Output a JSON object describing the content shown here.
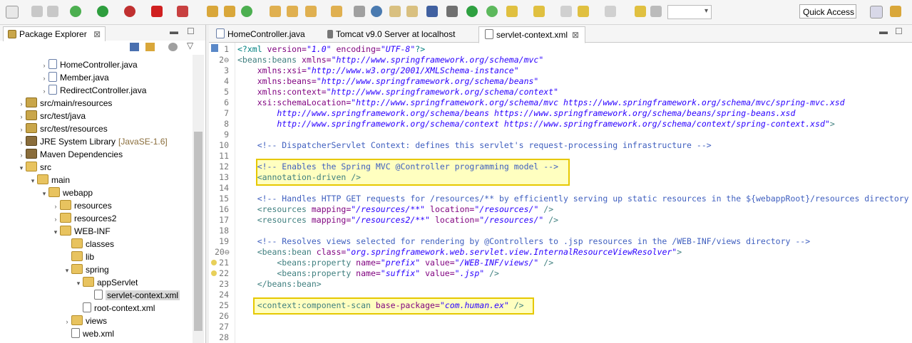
{
  "toolbar": {
    "quick_access": "Quick Access"
  },
  "package_explorer": {
    "title": "Package Explorer",
    "tree": [
      {
        "label": "HomeController.java",
        "extra": "",
        "depth": 4,
        "icon": "java",
        "twisty": ">"
      },
      {
        "label": "Member.java",
        "extra": "",
        "depth": 4,
        "icon": "java",
        "twisty": ">"
      },
      {
        "label": "RedirectController.java",
        "extra": "",
        "depth": 4,
        "icon": "java",
        "twisty": ">"
      },
      {
        "label": "src/main/resources",
        "extra": "",
        "depth": 2,
        "icon": "pkg",
        "twisty": ">"
      },
      {
        "label": "src/test/java",
        "extra": "",
        "depth": 2,
        "icon": "pkg",
        "twisty": ">"
      },
      {
        "label": "src/test/resources",
        "extra": "",
        "depth": 2,
        "icon": "pkg",
        "twisty": ">"
      },
      {
        "label": "JRE System Library",
        "extra": "[JavaSE-1.6]",
        "depth": 2,
        "icon": "lib",
        "twisty": ">"
      },
      {
        "label": "Maven Dependencies",
        "extra": "",
        "depth": 2,
        "icon": "lib",
        "twisty": ">"
      },
      {
        "label": "src",
        "extra": "",
        "depth": 2,
        "icon": "fold",
        "twisty": "v"
      },
      {
        "label": "main",
        "extra": "",
        "depth": 3,
        "icon": "fold",
        "twisty": "v"
      },
      {
        "label": "webapp",
        "extra": "",
        "depth": 4,
        "icon": "fold",
        "twisty": "v"
      },
      {
        "label": "resources",
        "extra": "",
        "depth": 5,
        "icon": "fold",
        "twisty": ">"
      },
      {
        "label": "resources2",
        "extra": "",
        "depth": 5,
        "icon": "fold",
        "twisty": ">"
      },
      {
        "label": "WEB-INF",
        "extra": "",
        "depth": 5,
        "icon": "fold",
        "twisty": "v"
      },
      {
        "label": "classes",
        "extra": "",
        "depth": 6,
        "icon": "fold",
        "twisty": ""
      },
      {
        "label": "lib",
        "extra": "",
        "depth": 6,
        "icon": "fold",
        "twisty": ""
      },
      {
        "label": "spring",
        "extra": "",
        "depth": 6,
        "icon": "fold",
        "twisty": "v"
      },
      {
        "label": "appServlet",
        "extra": "",
        "depth": 7,
        "icon": "fold",
        "twisty": "v"
      },
      {
        "label": "servlet-context.xml",
        "extra": "",
        "depth": 8,
        "icon": "xml",
        "twisty": "",
        "selected": true
      },
      {
        "label": "root-context.xml",
        "extra": "",
        "depth": 7,
        "icon": "xml",
        "twisty": ""
      },
      {
        "label": "views",
        "extra": "",
        "depth": 6,
        "icon": "fold",
        "twisty": ">"
      },
      {
        "label": "web.xml",
        "extra": "",
        "depth": 6,
        "icon": "xml",
        "twisty": ""
      }
    ]
  },
  "editor": {
    "tabs": [
      {
        "label": "HomeController.java",
        "active": false
      },
      {
        "label": "Tomcat v9.0 Server at localhost",
        "active": false
      },
      {
        "label": "servlet-context.xml",
        "active": true
      }
    ],
    "lines": [
      {
        "n": "1",
        "segs": [
          [
            "pi",
            "<?xml "
          ],
          [
            "attr",
            "version="
          ],
          [
            "val",
            "\"1.0\""
          ],
          [
            "attr",
            " encoding="
          ],
          [
            "val",
            "\"UTF-8\""
          ],
          [
            "pi",
            "?>"
          ]
        ]
      },
      {
        "n": "2⊖",
        "segs": [
          [
            "tag",
            "<beans:beans "
          ],
          [
            "attr",
            "xmlns="
          ],
          [
            "val",
            "\"http://www.springframework.org/schema/mvc\""
          ]
        ]
      },
      {
        "n": "3",
        "segs": [
          [
            "attr",
            "    xmlns:xsi="
          ],
          [
            "val",
            "\"http://www.w3.org/2001/XMLSchema-instance\""
          ]
        ]
      },
      {
        "n": "4",
        "segs": [
          [
            "attr",
            "    xmlns:beans="
          ],
          [
            "val",
            "\"http://www.springframework.org/schema/beans\""
          ]
        ]
      },
      {
        "n": "5",
        "segs": [
          [
            "attr",
            "    xmlns:context="
          ],
          [
            "val",
            "\"http://www.springframework.org/schema/context\""
          ]
        ]
      },
      {
        "n": "6",
        "segs": [
          [
            "attr",
            "    xsi:schemaLocation="
          ],
          [
            "val",
            "\"http://www.springframework.org/schema/mvc https://www.springframework.org/schema/mvc/spring-mvc.xsd"
          ]
        ]
      },
      {
        "n": "7",
        "segs": [
          [
            "val",
            "        http://www.springframework.org/schema/beans https://www.springframework.org/schema/beans/spring-beans.xsd"
          ]
        ]
      },
      {
        "n": "8",
        "segs": [
          [
            "val",
            "        http://www.springframework.org/schema/context https://www.springframework.org/schema/context/spring-context.xsd\""
          ],
          [
            "tag",
            ">"
          ]
        ]
      },
      {
        "n": "9",
        "segs": []
      },
      {
        "n": "10",
        "segs": [
          [
            "com",
            "    <!-- DispatcherServlet Context: defines this servlet's request-processing infrastructure -->"
          ]
        ]
      },
      {
        "n": "11",
        "segs": []
      },
      {
        "n": "12",
        "segs": [
          [
            "com",
            "    <!-- Enables the Spring MVC @Controller programming model -->"
          ]
        ]
      },
      {
        "n": "13",
        "segs": [
          [
            "tag",
            "    <annotation-driven />"
          ]
        ]
      },
      {
        "n": "14",
        "segs": []
      },
      {
        "n": "15",
        "segs": [
          [
            "com",
            "    <!-- Handles HTTP GET requests for /resources/** by efficiently serving up static resources in the ${webappRoot}/resources directory -->"
          ]
        ]
      },
      {
        "n": "16",
        "segs": [
          [
            "tag",
            "    <resources "
          ],
          [
            "attr",
            "mapping="
          ],
          [
            "val",
            "\"/resources/**\""
          ],
          [
            "attr",
            " location="
          ],
          [
            "val",
            "\"/resources/\""
          ],
          [
            "tag",
            " />"
          ]
        ]
      },
      {
        "n": "17",
        "segs": [
          [
            "tag",
            "    <resources "
          ],
          [
            "attr",
            "mapping="
          ],
          [
            "val",
            "\"/resources2/**\""
          ],
          [
            "attr",
            " location="
          ],
          [
            "val",
            "\"/resources/\""
          ],
          [
            "tag",
            " />"
          ]
        ]
      },
      {
        "n": "18",
        "segs": []
      },
      {
        "n": "19",
        "segs": [
          [
            "com",
            "    <!-- Resolves views selected for rendering by @Controllers to .jsp resources in the /WEB-INF/views directory -->"
          ]
        ]
      },
      {
        "n": "20⊖",
        "segs": [
          [
            "tag",
            "    <beans:bean "
          ],
          [
            "attr",
            "class="
          ],
          [
            "val",
            "\"org.springframework.web.servlet.view.InternalResourceViewResolver\""
          ],
          [
            "tag",
            ">"
          ]
        ]
      },
      {
        "n": "21",
        "segs": [
          [
            "tag",
            "        <beans:property "
          ],
          [
            "attr",
            "name="
          ],
          [
            "val",
            "\"prefix\""
          ],
          [
            "attr",
            " value="
          ],
          [
            "val",
            "\"/WEB-INF/views/\""
          ],
          [
            "tag",
            " />"
          ]
        ]
      },
      {
        "n": "22",
        "segs": [
          [
            "tag",
            "        <beans:property "
          ],
          [
            "attr",
            "name="
          ],
          [
            "val",
            "\"suffix\""
          ],
          [
            "attr",
            " value="
          ],
          [
            "val",
            "\".jsp\""
          ],
          [
            "tag",
            " />"
          ]
        ]
      },
      {
        "n": "23",
        "segs": [
          [
            "tag",
            "    </beans:bean>"
          ]
        ]
      },
      {
        "n": "24",
        "segs": []
      },
      {
        "n": "25",
        "segs": [
          [
            "tag",
            "    <context:component-scan "
          ],
          [
            "attr",
            "base-package="
          ],
          [
            "val",
            "\"com.human.ex\""
          ],
          [
            "tag",
            " />"
          ]
        ]
      },
      {
        "n": "26",
        "segs": []
      },
      {
        "n": "27",
        "segs": []
      },
      {
        "n": "28",
        "segs": []
      }
    ]
  }
}
